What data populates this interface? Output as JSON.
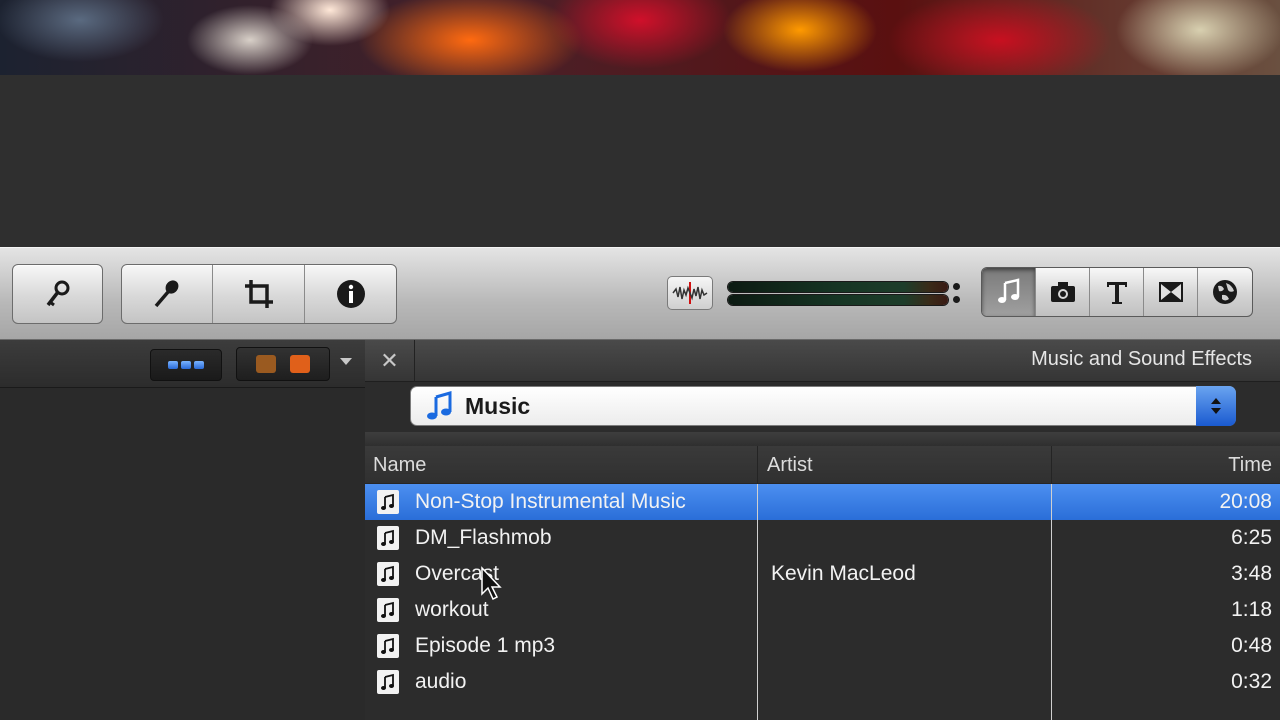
{
  "toolbar": {
    "left_tools": [
      "key-icon",
      "microphone-icon",
      "crop-icon",
      "info-icon"
    ],
    "browser_buttons": [
      "music-icon",
      "camera-icon",
      "text-icon",
      "transition-icon",
      "globe-icon"
    ],
    "active_browser": "music-icon"
  },
  "panel": {
    "close_label": "✕",
    "title": "Music and Sound Effects",
    "source": "Music"
  },
  "table": {
    "headers": {
      "name": "Name",
      "artist": "Artist",
      "time": "Time"
    },
    "rows": [
      {
        "name": "Non-Stop Instrumental Music",
        "artist": "",
        "time": "20:08",
        "selected": true
      },
      {
        "name": "DM_Flashmob",
        "artist": "",
        "time": "6:25",
        "selected": false
      },
      {
        "name": "Overcast",
        "artist": "Kevin MacLeod",
        "time": "3:48",
        "selected": false
      },
      {
        "name": "workout",
        "artist": "",
        "time": "1:18",
        "selected": false
      },
      {
        "name": "Episode 1 mp3",
        "artist": "",
        "time": "0:48",
        "selected": false
      },
      {
        "name": "audio",
        "artist": "",
        "time": "0:32",
        "selected": false
      }
    ]
  },
  "colors": {
    "selection": "#2a6ed8",
    "accent_blue": "#1a5ad0",
    "marker_orange": "#e0601a",
    "marker_brown": "#9a5a20"
  }
}
